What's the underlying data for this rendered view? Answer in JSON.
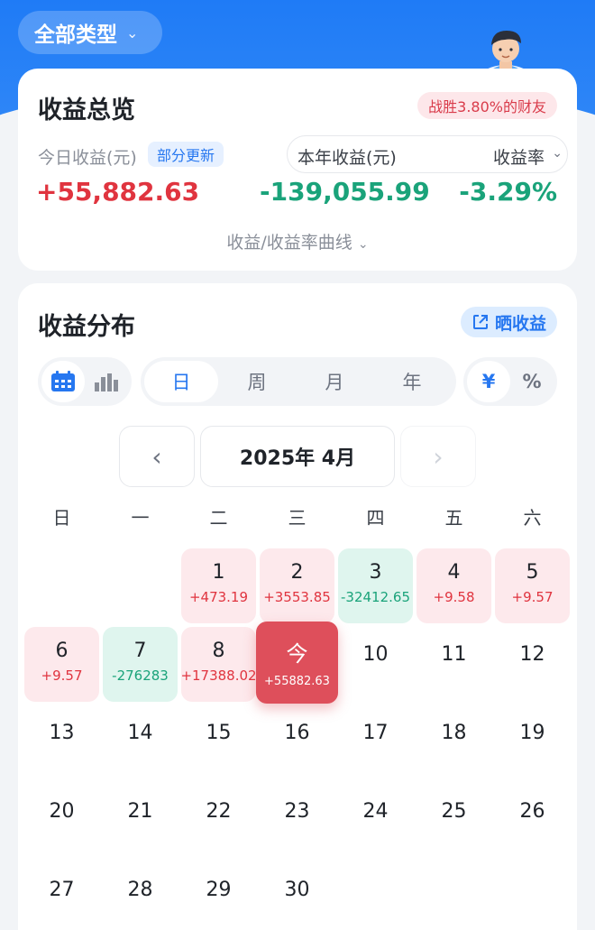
{
  "header": {
    "type_select": "全部类型"
  },
  "overview": {
    "title": "收益总览",
    "win_badge": "战胜3.80%的财友",
    "today_label": "今日收益(元)",
    "partial_tag": "部分更新",
    "year_label": "本年收益(元)",
    "rate_label": "收益率",
    "today_value": "+55,882.63",
    "year_value": "-139,055.99",
    "rate_value": "-3.29%",
    "curve_link": "收益/收益率曲线"
  },
  "distribution": {
    "title": "收益分布",
    "share_label": "晒收益",
    "periods": [
      "日",
      "周",
      "月",
      "年"
    ],
    "active_period": "日",
    "units": [
      "¥",
      "%"
    ],
    "active_unit": "¥",
    "month_label": "2025年 4月",
    "weekdays": [
      "日",
      "一",
      "二",
      "三",
      "四",
      "五",
      "六"
    ],
    "days": [
      {
        "day": "1",
        "value": "+473.19",
        "kind": "pos"
      },
      {
        "day": "2",
        "value": "+3553.85",
        "kind": "pos"
      },
      {
        "day": "3",
        "value": "-32412.65",
        "kind": "neg"
      },
      {
        "day": "4",
        "value": "+9.58",
        "kind": "pos"
      },
      {
        "day": "5",
        "value": "+9.57",
        "kind": "pos"
      },
      {
        "day": "6",
        "value": "+9.57",
        "kind": "pos"
      },
      {
        "day": "7",
        "value": "-276283",
        "kind": "neg"
      },
      {
        "day": "8",
        "value": "+17388.02",
        "kind": "pos"
      },
      {
        "day": "今",
        "value": "+55882.63",
        "kind": "today"
      },
      {
        "day": "10"
      },
      {
        "day": "11"
      },
      {
        "day": "12"
      },
      {
        "day": "13"
      },
      {
        "day": "14"
      },
      {
        "day": "15"
      },
      {
        "day": "16"
      },
      {
        "day": "17"
      },
      {
        "day": "18"
      },
      {
        "day": "19"
      },
      {
        "day": "20"
      },
      {
        "day": "21"
      },
      {
        "day": "22"
      },
      {
        "day": "23"
      },
      {
        "day": "24"
      },
      {
        "day": "25"
      },
      {
        "day": "26"
      },
      {
        "day": "27"
      },
      {
        "day": "28"
      },
      {
        "day": "29"
      },
      {
        "day": "30"
      }
    ],
    "first_weekday_index": 2
  },
  "colors": {
    "accent": "#2677f0",
    "positive": "#e0343f",
    "negative": "#1aa37a",
    "today": "#de4f5b"
  }
}
